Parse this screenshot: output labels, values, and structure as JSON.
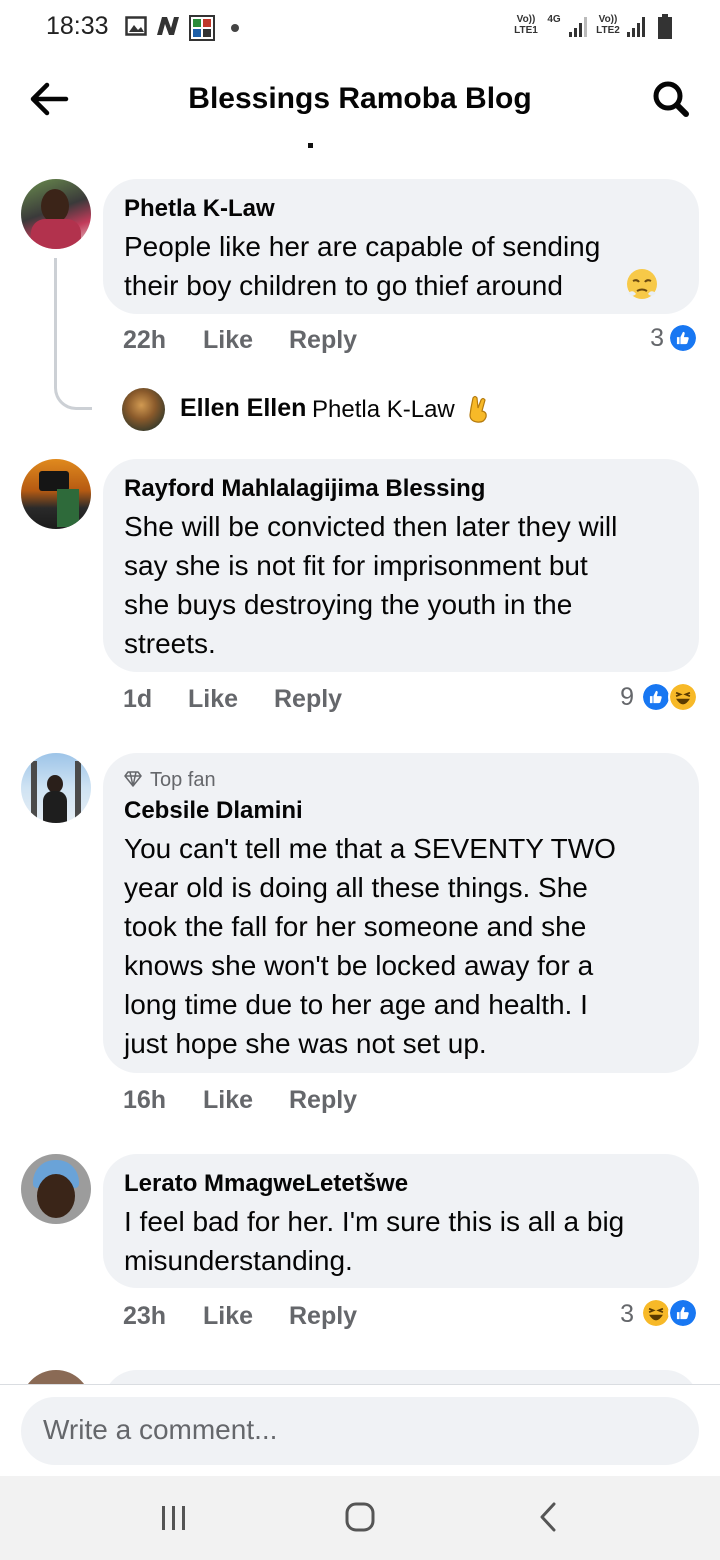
{
  "status_bar": {
    "time": "18:33",
    "icons": [
      "gallery-icon",
      "nfc-icon",
      "app-icon",
      "notification-dot"
    ],
    "sim1": "Vo)) LTE1",
    "network": "4G",
    "sim2": "Vo)) LTE2"
  },
  "header": {
    "title": "Blessings Ramoba Blog",
    "back_icon": "arrow-left-icon",
    "search_icon": "search-icon"
  },
  "comments": [
    {
      "author": "Phetla K-Law",
      "text": "People like her are capable of sending\ntheir boy children to go thief around",
      "text_emoji": "triumph-face-emoji",
      "time": "22h",
      "like": "Like",
      "reply": "Reply",
      "reaction_count": "3",
      "reactions": [
        "like"
      ]
    },
    {
      "author": "Rayford Mahlalagijima Blessing",
      "text": "She will be convicted then later they will\nsay she is not fit for imprisonment but\nshe buys destroying the youth in the\nstreets.",
      "time": "1d",
      "like": "Like",
      "reply": "Reply",
      "reaction_count": "9",
      "reactions": [
        "like",
        "haha"
      ]
    },
    {
      "badge": "Top fan",
      "author": "Cebsile Dlamini",
      "text": "You can't tell me that a SEVENTY TWO\nyear old is doing all these things. She\ntook the fall for her someone and she\nknows she won't be locked away for a\nlong time due to her age and health. I\njust hope she was not set up.",
      "time": "16h",
      "like": "Like",
      "reply": "Reply"
    },
    {
      "author": "Lerato MmagweLetetšwe",
      "text": "I feel bad for her. I'm sure this is all a big\nmisunderstanding.",
      "time": "23h",
      "like": "Like",
      "reply": "Reply",
      "reaction_count": "3",
      "reactions": [
        "haha",
        "like"
      ]
    }
  ],
  "reply_preview": {
    "author": "Ellen Ellen",
    "mention": "Phetla K-Law",
    "emoji": "crossed-fingers-emoji"
  },
  "composer": {
    "placeholder": "Write a comment..."
  },
  "nav_bar": {
    "buttons": [
      "recent-apps",
      "home",
      "back"
    ]
  },
  "colors": {
    "bubble": "#f0f2f5",
    "secondary_text": "#65676b",
    "like_blue": "#1877f2",
    "haha_yellow": "#f7b928"
  }
}
